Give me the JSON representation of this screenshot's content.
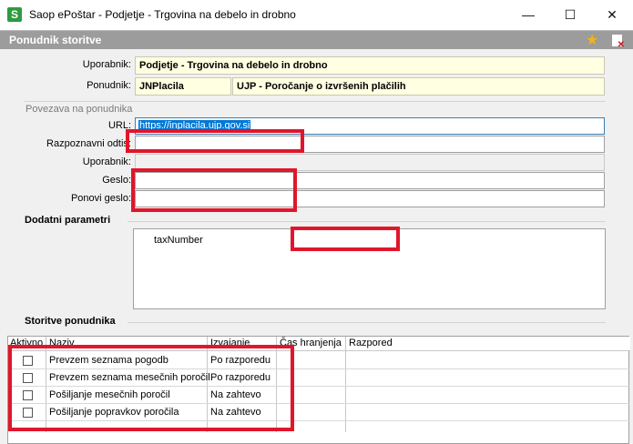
{
  "window": {
    "title": "Saop ePoštar - Podjetje - Trgovina na debelo in drobno",
    "app_icon_letter": "S"
  },
  "header": {
    "title": "Ponudnik storitve"
  },
  "fields": {
    "uporabnik_label": "Uporabnik:",
    "uporabnik_value": "Podjetje - Trgovina na debelo in drobno",
    "ponudnik_label": "Ponudnik:",
    "ponudnik_code": "JNPlacila",
    "ponudnik_name": "UJP - Poročanje o izvršenih plačilih"
  },
  "connection": {
    "group_label": "Povezava na ponudnika",
    "url_label": "URL:",
    "url_value": "https://inplacila.ujp.gov.si",
    "razpoznavni_label": "Razpoznavni odtis:",
    "razpoznavni_value": "",
    "uporabnik_label": "Uporabnik:",
    "uporabnik_value": "",
    "geslo_label": "Geslo:",
    "geslo_value": "",
    "ponovi_label": "Ponovi geslo:",
    "ponovi_value": ""
  },
  "params": {
    "title": "Dodatni parametri",
    "items": [
      {
        "name": "taxNumber",
        "value": ""
      }
    ]
  },
  "services": {
    "title": "Storitve ponudnika",
    "columns": [
      "Aktivno",
      "Naziv",
      "Izvajanje",
      "Čas hranjenja",
      "Razpored"
    ],
    "rows": [
      {
        "active": false,
        "naziv": "Prevzem seznama pogodb",
        "izvajanje": "Po razporedu",
        "cas": "",
        "razpored": ""
      },
      {
        "active": false,
        "naziv": "Prevzem seznama mesečnih poročil",
        "izvajanje": "Po razporedu",
        "cas": "",
        "razpored": ""
      },
      {
        "active": false,
        "naziv": "Pošiljanje mesečnih poročil",
        "izvajanje": "Na zahtevo",
        "cas": "",
        "razpored": ""
      },
      {
        "active": false,
        "naziv": "Pošiljanje popravkov poročila",
        "izvajanje": "Na zahtevo",
        "cas": "",
        "razpored": ""
      }
    ]
  },
  "icons": [
    "star-icon",
    "close-doc-icon",
    "minimize-icon",
    "maximize-icon",
    "close-icon"
  ],
  "colors": {
    "header_bg": "#9c9c9c",
    "readonly_bg": "#ffffe1",
    "highlight_red": "#e0162b",
    "selection": "#0078d7"
  }
}
